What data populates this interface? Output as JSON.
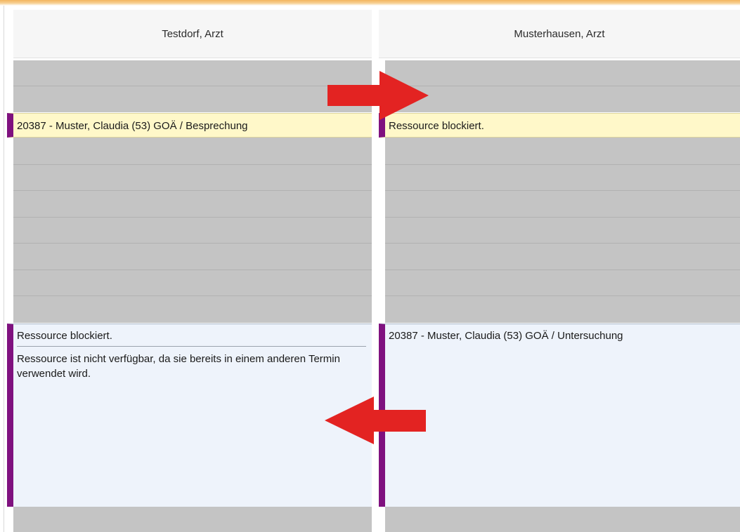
{
  "columns": [
    {
      "header": "Testdorf, Arzt",
      "upper_appointment": "20387 - Muster, Claudia (53) GOÄ / Besprechung",
      "lower_appointment": {
        "title": "Ressource blockiert.",
        "description": "Ressource ist nicht verfügbar, da sie bereits in einem anderen Termin verwendet wird."
      }
    },
    {
      "header": "Musterhausen, Arzt",
      "upper_appointment": "Ressource blockiert.",
      "lower_appointment": {
        "title": "20387 - Muster, Claudia (53) GOÄ / Untersuchung"
      }
    }
  ],
  "colors": {
    "appointment_marker": "#7f117f",
    "blocked_slot": "#c4c4c4",
    "short_appointment_bg": "#fff8c9",
    "long_appointment_bg": "#eef3fb",
    "arrow": "#e32322",
    "top_accent": "#f3b45c"
  },
  "annotations": [
    {
      "name": "arrow-right-icon",
      "direction": "right"
    },
    {
      "name": "arrow-left-icon",
      "direction": "left"
    }
  ]
}
